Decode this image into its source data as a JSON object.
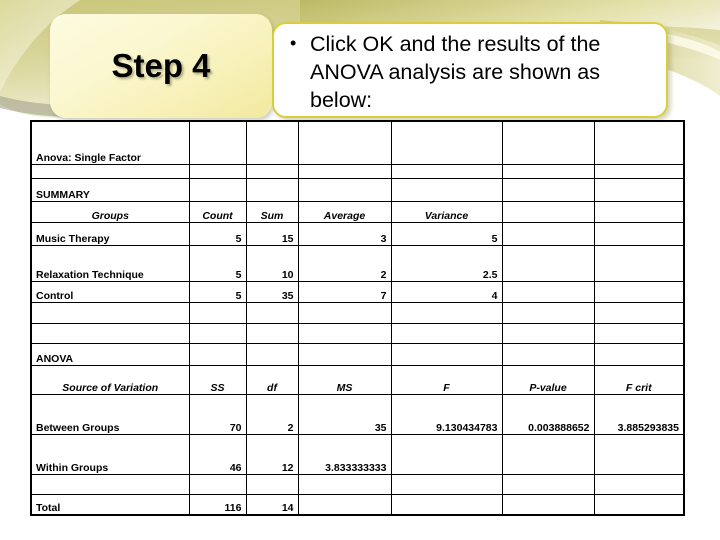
{
  "slide": {
    "step_title": "Step 4",
    "callout_bullets": [
      "Click OK and the results of the ANOVA analysis are shown as below:"
    ],
    "accent_border_color": "#d9cf3d",
    "step_box_color": "#fbf7cf",
    "background_color": "#ffffff"
  },
  "spreadsheet": {
    "title_cell": "Anova: Single Factor",
    "summary_heading": "SUMMARY",
    "anova_heading": "ANOVA",
    "summary_headers": {
      "groups": "Groups",
      "count": "Count",
      "sum": "Sum",
      "average": "Average",
      "variance": "Variance"
    },
    "summary_rows": [
      {
        "group": "Music Therapy",
        "count": "5",
        "sum": "15",
        "average": "3",
        "variance": "5"
      },
      {
        "group": "Relaxation Technique",
        "count": "5",
        "sum": "10",
        "average": "2",
        "variance": "2.5"
      },
      {
        "group": "Control",
        "count": "5",
        "sum": "35",
        "average": "7",
        "variance": "4"
      }
    ],
    "anova_headers": {
      "source": "Source of Variation",
      "ss": "SS",
      "df": "df",
      "ms": "MS",
      "f": "F",
      "p_value": "P-value",
      "f_crit": "F crit"
    },
    "anova_rows": [
      {
        "source": "Between Groups",
        "ss": "70",
        "df": "2",
        "ms": "35",
        "f": "9.130434783",
        "p_value": "0.003888652",
        "f_crit": "3.885293835"
      },
      {
        "source": "Within Groups",
        "ss": "46",
        "df": "12",
        "ms": "3.833333333",
        "f": "",
        "p_value": "",
        "f_crit": ""
      },
      {
        "source": "Total",
        "ss": "116",
        "df": "14",
        "ms": "",
        "f": "",
        "p_value": "",
        "f_crit": ""
      }
    ]
  }
}
